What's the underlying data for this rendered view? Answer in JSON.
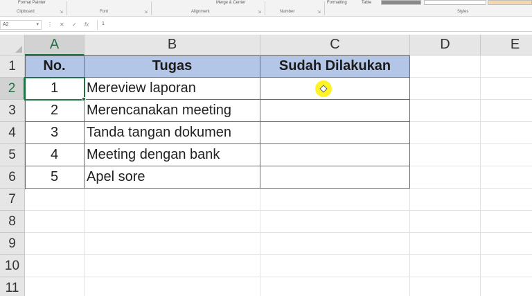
{
  "ribbon": {
    "format_painter": "Format Painter",
    "merge_center": "Merge & Center",
    "formatting": "Formatting",
    "table": "Table",
    "groups": {
      "clipboard": "Clipboard",
      "font": "Font",
      "alignment": "Alignment",
      "number": "Number",
      "styles": "Styles"
    }
  },
  "formula_bar": {
    "name_box": "A2",
    "fx": "fx",
    "cancel": "✕",
    "enter": "✓",
    "formula": "1"
  },
  "columns": [
    "A",
    "B",
    "C",
    "D",
    "E"
  ],
  "rows": [
    "1",
    "2",
    "3",
    "4",
    "5",
    "6",
    "7",
    "8",
    "9",
    "10",
    "11"
  ],
  "table": {
    "headers": [
      "No.",
      "Tugas",
      "Sudah Dilakukan"
    ],
    "rows": [
      [
        "1",
        "Mereview laporan",
        ""
      ],
      [
        "2",
        "Merencanakan meeting",
        ""
      ],
      [
        "3",
        "Tanda tangan dokumen",
        ""
      ],
      [
        "4",
        "Meeting dengan bank",
        ""
      ],
      [
        "5",
        "Apel sore",
        ""
      ]
    ]
  },
  "selection": {
    "cell": "A2"
  },
  "colors": {
    "header_fill": "#b4c6e7",
    "selection": "#217346",
    "cursor_highlight": "#fff200"
  }
}
